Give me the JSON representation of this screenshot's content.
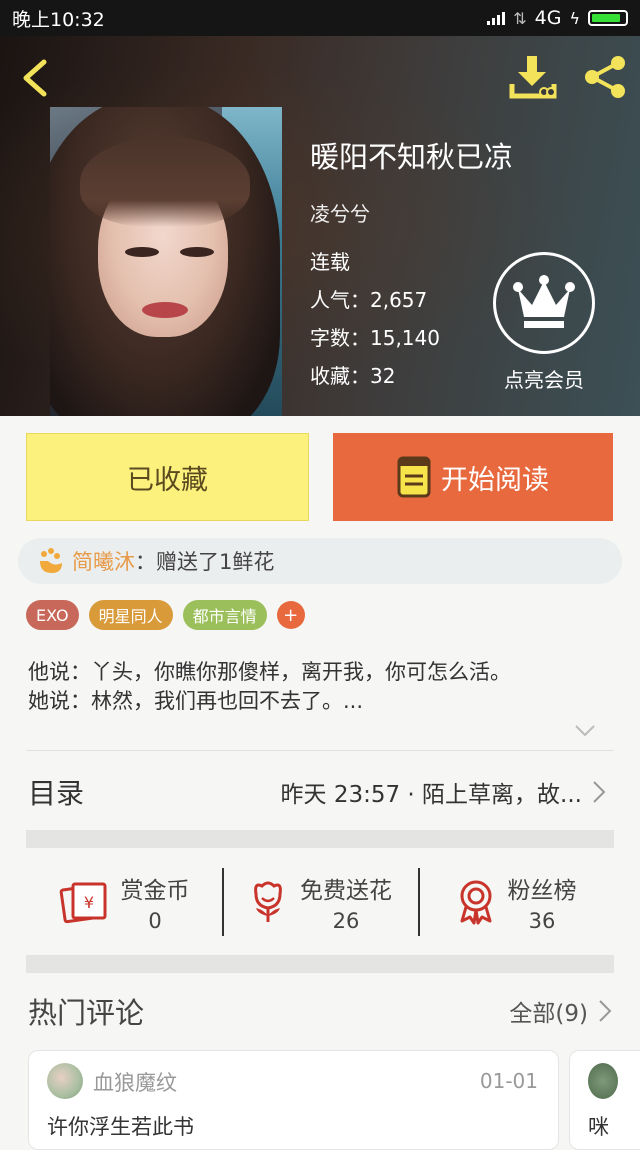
{
  "status_bar": {
    "time": "晚上10:32",
    "network": "4G"
  },
  "book": {
    "title": "暖阳不知秋已凉",
    "author": "凌兮兮",
    "status": "连载",
    "popularity": "人气：2,657",
    "word_count": "字数：15,140",
    "favorites": "收藏：32"
  },
  "vip": {
    "label": "点亮会员"
  },
  "actions": {
    "favorited_label": "已收藏",
    "read_label": "开始阅读"
  },
  "gift_notice": {
    "user": "简曦沐",
    "text": "：赠送了1鲜花"
  },
  "tags": [
    {
      "label": "EXO",
      "color": "#c8685a"
    },
    {
      "label": "明星同人",
      "color": "#d99a3a"
    },
    {
      "label": "都市言情",
      "color": "#9bbf5a"
    }
  ],
  "tag_add": "+",
  "description": {
    "line1": "他说：丫头，你瞧你那傻样，离开我，你可怎么活。",
    "line2": "她说：林然，我们再也回不去了。..."
  },
  "toc": {
    "label": "目录",
    "latest": "昨天 23:57 · 陌上草离，故..."
  },
  "stats": [
    {
      "label": "赏金币",
      "value": "0",
      "icon": "red-envelope-icon"
    },
    {
      "label": "免费送花",
      "value": "26",
      "icon": "flower-icon"
    },
    {
      "label": "粉丝榜",
      "value": "36",
      "icon": "award-icon"
    }
  ],
  "comments": {
    "heading": "热门评论",
    "all_label": "全部(9)",
    "items": [
      {
        "user": "血狼魔纹",
        "date": "01-01",
        "text": "许你浮生若此书"
      },
      {
        "text": "咪"
      }
    ]
  },
  "colors": {
    "accent_orange": "#e8693e",
    "fav_yellow": "#fbf17c",
    "icon_yellow": "#f2e35a",
    "icon_red": "#c8342b"
  }
}
